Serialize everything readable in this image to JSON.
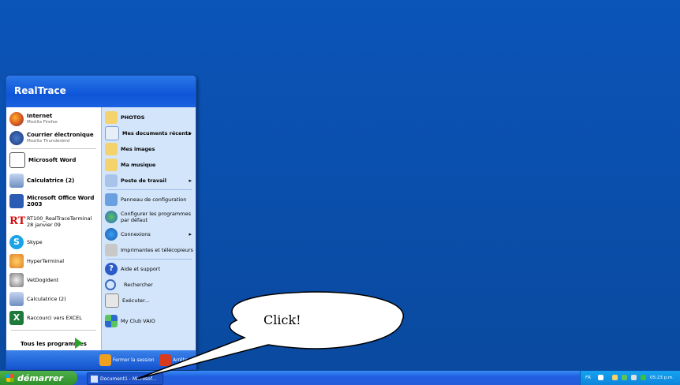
{
  "start_menu": {
    "user_name": "RealTrace",
    "left_pinned": [
      {
        "label": "Internet",
        "sub": "Mozilla Firefox",
        "icon": "firefox-icon"
      },
      {
        "label": "Courrier électronique",
        "sub": "Mozilla Thunderbird",
        "icon": "thunderbird-icon"
      }
    ],
    "left_recent": [
      {
        "label": "Microsoft Word",
        "icon": "word-icon"
      },
      {
        "label": "Calculatrice (2)",
        "icon": "calculator-icon"
      },
      {
        "label": "Microsoft Office Word 2003",
        "icon": "word-2003-icon"
      },
      {
        "label": "RT100_RealTraceTerminal",
        "sub": "28 janvier 09",
        "icon": "realtrace-icon"
      },
      {
        "label": "Skype",
        "icon": "skype-icon"
      },
      {
        "label": "HyperTerminal",
        "icon": "hyperterminal-icon"
      },
      {
        "label": "VetDogIdent",
        "icon": "vetdogident-icon"
      },
      {
        "label": "Calculatrice (2)",
        "icon": "calculator-icon"
      },
      {
        "label": "Raccourci vers EXCEL",
        "icon": "excel-icon"
      }
    ],
    "all_programs": "Tous les programmes",
    "right_items": [
      {
        "label": "PHOTOS",
        "bold": true
      },
      {
        "label": "Mes documents récents",
        "bold": true,
        "arrow": "▸"
      },
      {
        "label": "Mes images",
        "bold": true
      },
      {
        "label": "Ma musique",
        "bold": true
      },
      {
        "label": "Poste de travail",
        "bold": true,
        "arrow": "▸"
      },
      {
        "label": "Panneau de configuration"
      },
      {
        "label": "Configurer les programmes par défaut"
      },
      {
        "label": "Connexions",
        "arrow": "▸"
      },
      {
        "label": "Imprimantes et télécopieurs"
      },
      {
        "label": "Aide et support"
      },
      {
        "label": "Rechercher"
      },
      {
        "label": "Exécuter..."
      },
      {
        "label": "My Club VAIO"
      }
    ],
    "logoff_label": "Fermer la session",
    "shutdown_label": "Arrêter"
  },
  "taskbar": {
    "start_label": "démarrer",
    "task_label": "Document1 - Microsof...",
    "tray_lang": "FR",
    "clock": "05:23 p.m."
  },
  "callout": {
    "text": "Click!"
  },
  "colors": {
    "desktop": "#0a4fa8",
    "start_green": "#3a9a35",
    "taskbar_blue": "#245ddb"
  }
}
